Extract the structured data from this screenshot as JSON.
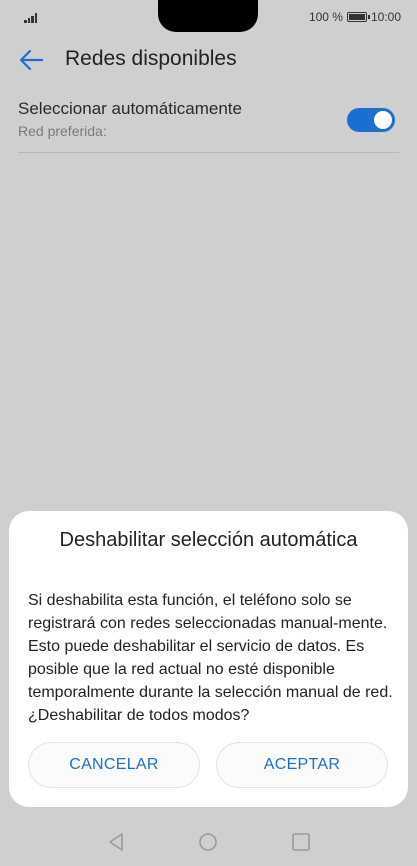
{
  "status_bar": {
    "battery_text": "100 %",
    "time": "10:00"
  },
  "header": {
    "title": "Redes disponibles",
    "back_icon": "arrow-left-icon"
  },
  "setting": {
    "title": "Seleccionar automáticamente",
    "subtitle": "Red preferida:",
    "toggle_on": true
  },
  "dialog": {
    "title": "Deshabilitar selección automática",
    "message": "Si deshabilita esta función, el teléfono solo se registrará con redes seleccionadas manual-mente. Esto puede deshabilitar el servicio de datos. Es posible que la red actual no esté disponible temporalmente durante la selección manual de red. ¿Deshabilitar de todos modos?",
    "cancel_label": "CANCELAR",
    "accept_label": "ACEPTAR"
  },
  "colors": {
    "accent": "#1a6fd0",
    "scrim": "#cfcfcf"
  }
}
